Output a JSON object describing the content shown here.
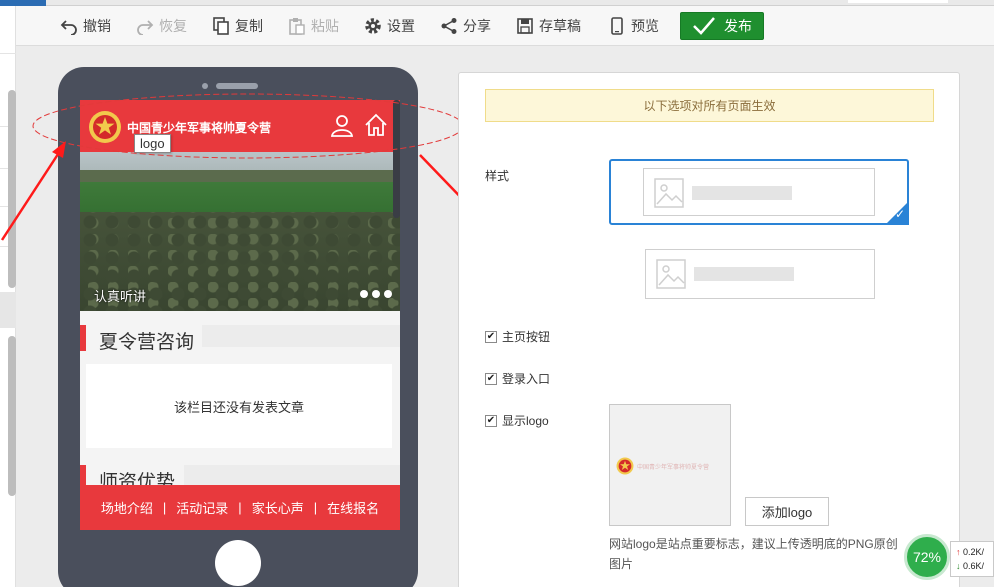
{
  "toolbar": {
    "undo": "撤销",
    "redo": "恢复",
    "copy": "复制",
    "paste": "粘贴",
    "settings": "设置",
    "share": "分享",
    "save_draft": "存草稿",
    "preview": "预览",
    "publish": "发布"
  },
  "mobile": {
    "logo_text": "中国青少年军事将帅夏令营",
    "logo_tooltip": "logo",
    "banner_caption": "认真听讲",
    "section1_title": "夏令营咨询",
    "section1_empty": "该栏目还没有发表文章",
    "section2_title": "师资优势",
    "nav": [
      "场地介绍",
      "活动记录",
      "家长心声",
      "在线报名"
    ],
    "nav_separator": "|"
  },
  "panel": {
    "notice": "以下选项对所有页面生效",
    "style_label": "样式",
    "checkboxes": [
      {
        "label": "主页按钮",
        "checked": true
      },
      {
        "label": "登录入口",
        "checked": true
      },
      {
        "label": "显示logo",
        "checked": true
      }
    ],
    "add_logo_button": "添加logo",
    "hint": "网站logo是站点重要标志，建议上传透明底的PNG原创图片"
  },
  "network": {
    "percent": "72%",
    "up": "0.2K/",
    "down": "0.6K/"
  },
  "colors": {
    "brand_red": "#e8393d",
    "publish_green": "#1f8f2f",
    "select_blue": "#2a83d6",
    "phone_body": "#4a4f5c"
  }
}
